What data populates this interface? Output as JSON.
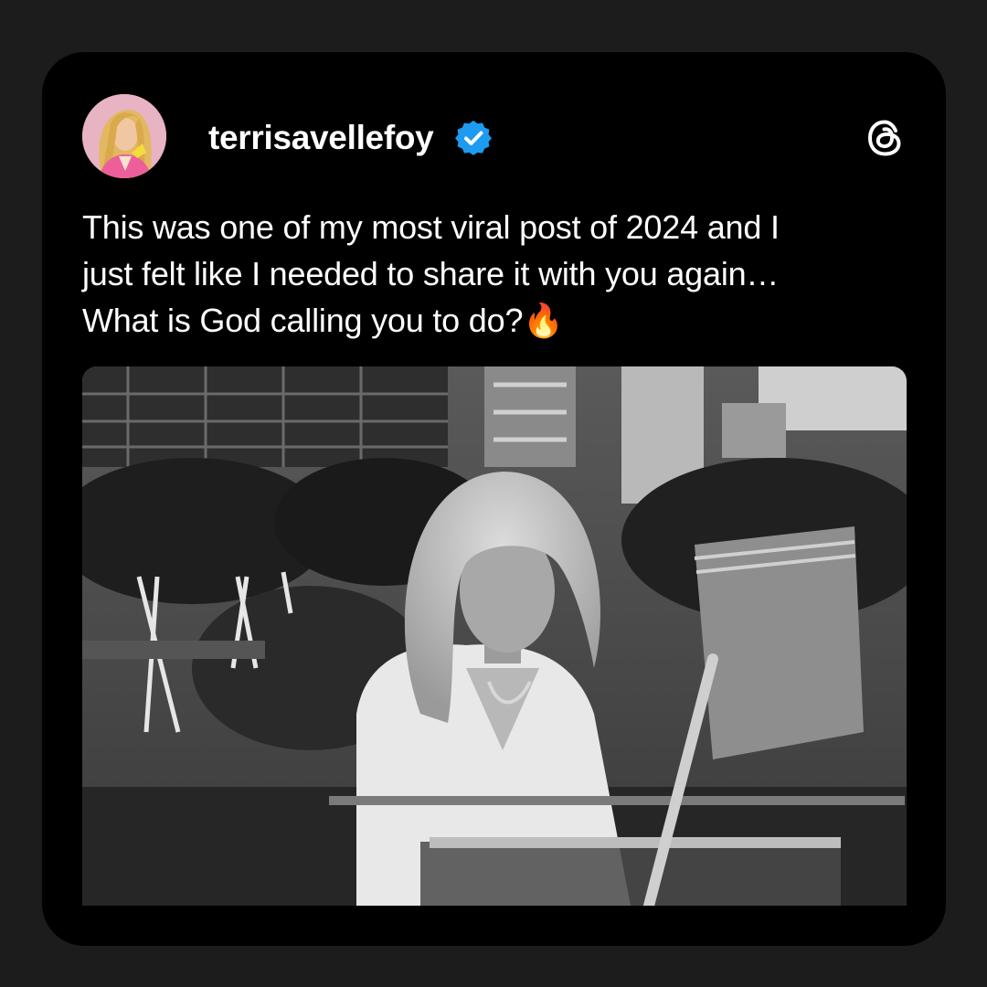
{
  "post": {
    "username": "terrisavellefoy",
    "verified": true,
    "text_lines": [
      "This was one of my most viral post of 2024 and I",
      "just felt like I needed to share it with you again…",
      "What is God calling you to do?🔥"
    ],
    "media_type": "video-frame-grayscale"
  },
  "icons": {
    "verified": "verified-badge-icon",
    "platform": "threads-logo-icon"
  },
  "colors": {
    "page_background": "#1c1c1c",
    "card_background": "#000000",
    "text": "#ffffff",
    "verified_blue": "#1d9bf0",
    "avatar_pink": "#e6a9ba"
  }
}
